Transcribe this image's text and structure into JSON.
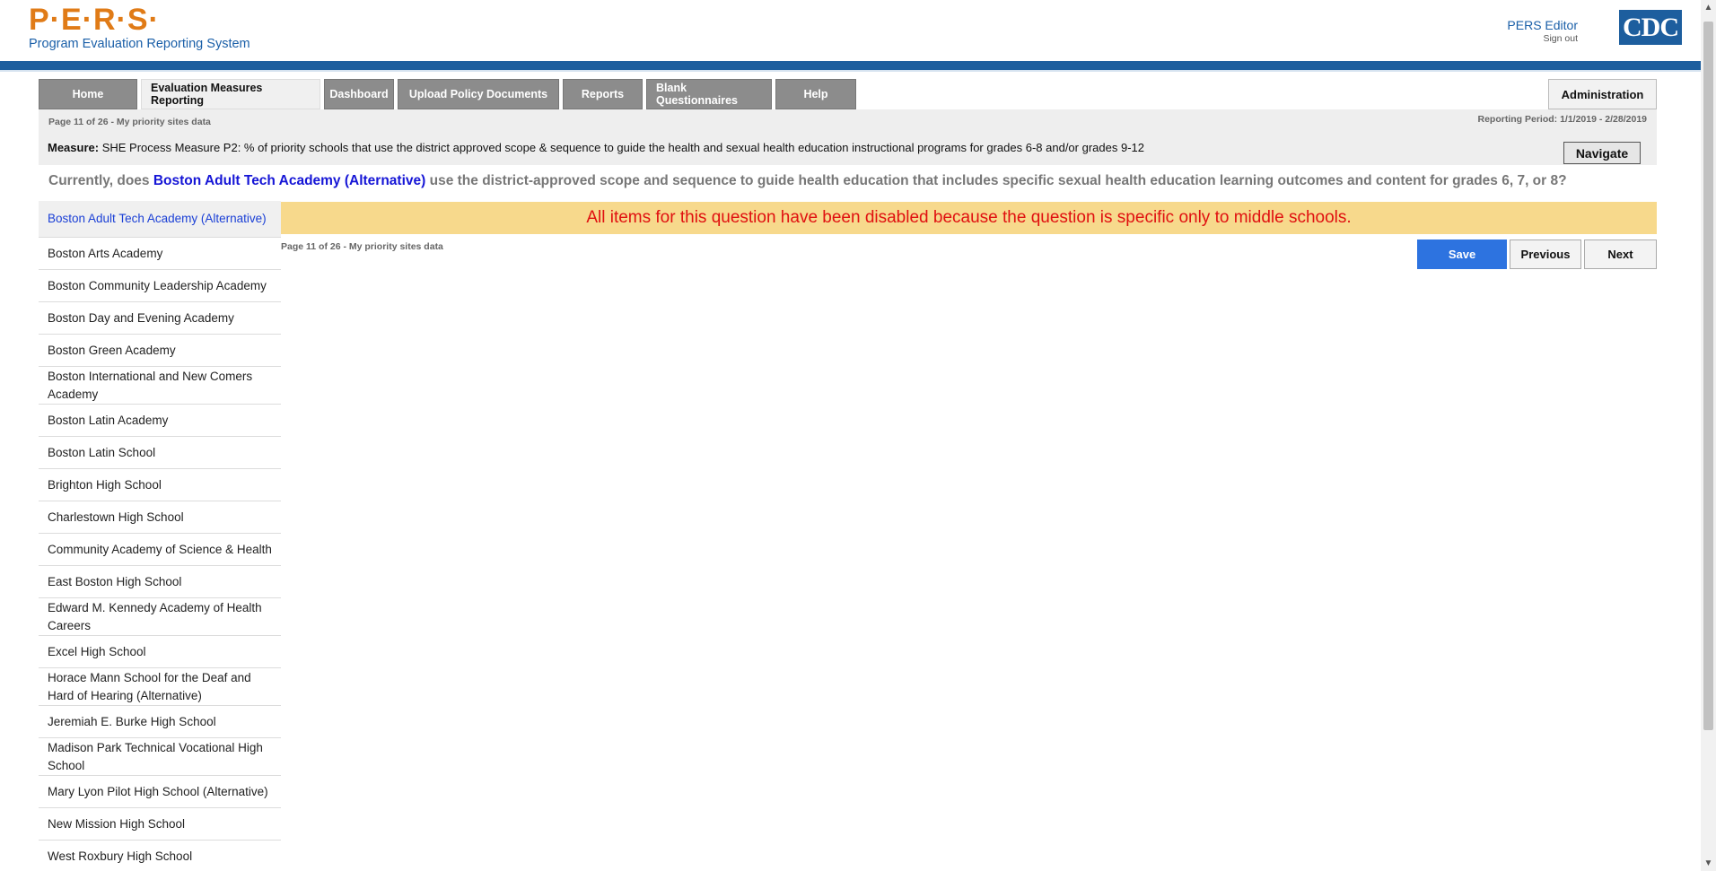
{
  "header": {
    "logo_text": "P·E·R·S·",
    "logo_subtitle": "Program Evaluation Reporting System",
    "user_name": "PERS Editor",
    "sign_out": "Sign out",
    "cdc_logo": "CDC"
  },
  "tabs": [
    {
      "label": "Home",
      "active": false
    },
    {
      "label": "Evaluation Measures Reporting",
      "active": true
    },
    {
      "label": "Dashboard",
      "active": false
    },
    {
      "label": "Upload Policy Documents",
      "active": false
    },
    {
      "label": "Reports",
      "active": false
    },
    {
      "label": "Blank Questionnaires",
      "active": false
    },
    {
      "label": "Help",
      "active": false
    }
  ],
  "admin_label": "Administration",
  "info": {
    "page_label": "Page 11 of 26 - My priority sites data",
    "reporting_period": "Reporting Period: 1/1/2019 - 2/28/2019"
  },
  "measure": {
    "label": "Measure:",
    "text": "SHE Process Measure P2: % of priority schools that use the district approved scope & sequence to guide the health and sexual health education instructional programs for grades 6-8 and/or grades 9-12",
    "navigate_label": "Navigate"
  },
  "question": {
    "prefix": "Currently, does ",
    "school": "Boston Adult Tech Academy (Alternative)",
    "suffix": " use the district-approved scope and sequence to guide health education that includes specific sexual health education learning outcomes and content for grades 6, 7, or 8?"
  },
  "sidebar": {
    "items": [
      {
        "label": "Boston Adult Tech Academy (Alternative)",
        "active": true
      },
      {
        "label": "Boston Arts Academy",
        "active": false
      },
      {
        "label": "Boston Community Leadership Academy",
        "active": false
      },
      {
        "label": "Boston Day and Evening Academy",
        "active": false
      },
      {
        "label": "Boston Green Academy",
        "active": false
      },
      {
        "label": "Boston International and New Comers Academy",
        "active": false
      },
      {
        "label": "Boston Latin Academy",
        "active": false
      },
      {
        "label": "Boston Latin School",
        "active": false
      },
      {
        "label": "Brighton High School",
        "active": false
      },
      {
        "label": "Charlestown High School",
        "active": false
      },
      {
        "label": "Community Academy of Science & Health",
        "active": false
      },
      {
        "label": "East Boston High School",
        "active": false
      },
      {
        "label": "Edward M. Kennedy Academy of Health Careers",
        "active": false
      },
      {
        "label": "Excel High School",
        "active": false
      },
      {
        "label": "Horace Mann School for the Deaf and Hard of Hearing (Alternative)",
        "active": false
      },
      {
        "label": "Jeremiah E. Burke High School",
        "active": false
      },
      {
        "label": "Madison Park Technical Vocational High School",
        "active": false
      },
      {
        "label": "Mary Lyon Pilot High School (Alternative)",
        "active": false
      },
      {
        "label": "New Mission High School",
        "active": false
      },
      {
        "label": "West Roxbury High School",
        "active": false
      }
    ]
  },
  "notice": "All items for this question have been disabled because the question is specific only to middle schools.",
  "page_note": "Page 11 of 26 - My priority sites data",
  "buttons": {
    "save": "Save",
    "previous": "Previous",
    "next": "Next"
  },
  "colors": {
    "brand_orange": "#e07b17",
    "brand_blue": "#1d5e9e",
    "notice_bg": "#f7d98c",
    "notice_text": "#e01010",
    "save_button": "#2d73e0",
    "tab_gray": "#8c8c8c"
  }
}
